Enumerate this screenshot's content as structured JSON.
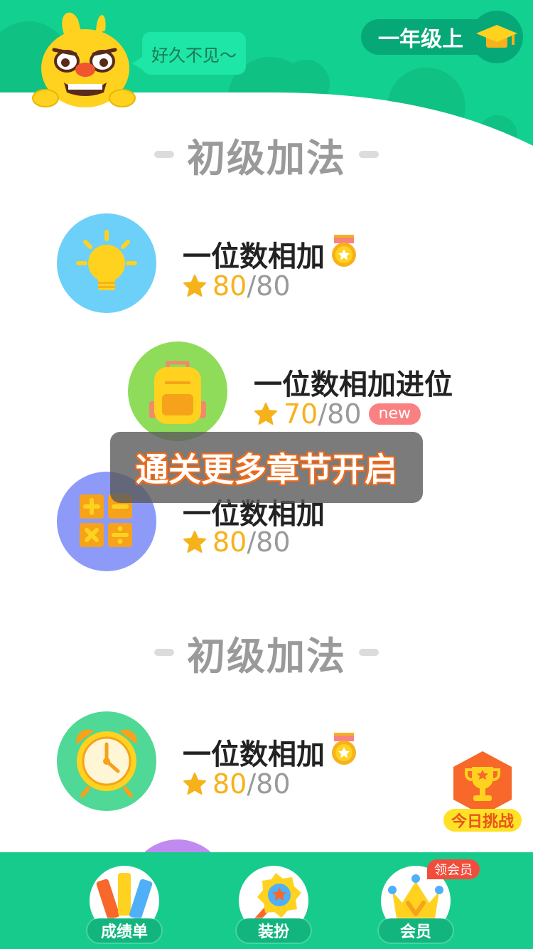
{
  "header": {
    "greeting": "好久不见～",
    "grade": "一年级上"
  },
  "sections": [
    {
      "title": "初级加法",
      "lessons": [
        {
          "title": "一位数相加",
          "score": "80",
          "total": "/80",
          "medal": true,
          "icon": "lightbulb-icon"
        },
        {
          "title": "一位数相加进位",
          "score": "70",
          "total": "/80",
          "badge": "new",
          "icon": "backpack-icon"
        },
        {
          "title": "一位数相加",
          "score": "80",
          "total": "/80",
          "icon": "calculator-icon"
        }
      ]
    },
    {
      "title": "初级加法",
      "lessons": [
        {
          "title": "一位数相加",
          "score": "80",
          "total": "/80",
          "medal": true,
          "icon": "alarm-clock-icon"
        }
      ]
    }
  ],
  "toast": "通关更多章节开启",
  "daily_challenge": "今日挑战",
  "tabs": [
    {
      "label": "成绩单",
      "icon": "pencils-icon"
    },
    {
      "label": "装扮",
      "icon": "star-wand-icon"
    },
    {
      "label": "会员",
      "icon": "crown-icon",
      "badge": "领会员"
    }
  ],
  "colors": {
    "brand_green": "#17cb8d",
    "score_orange": "#f6b21a",
    "new_badge": "#f98181"
  }
}
